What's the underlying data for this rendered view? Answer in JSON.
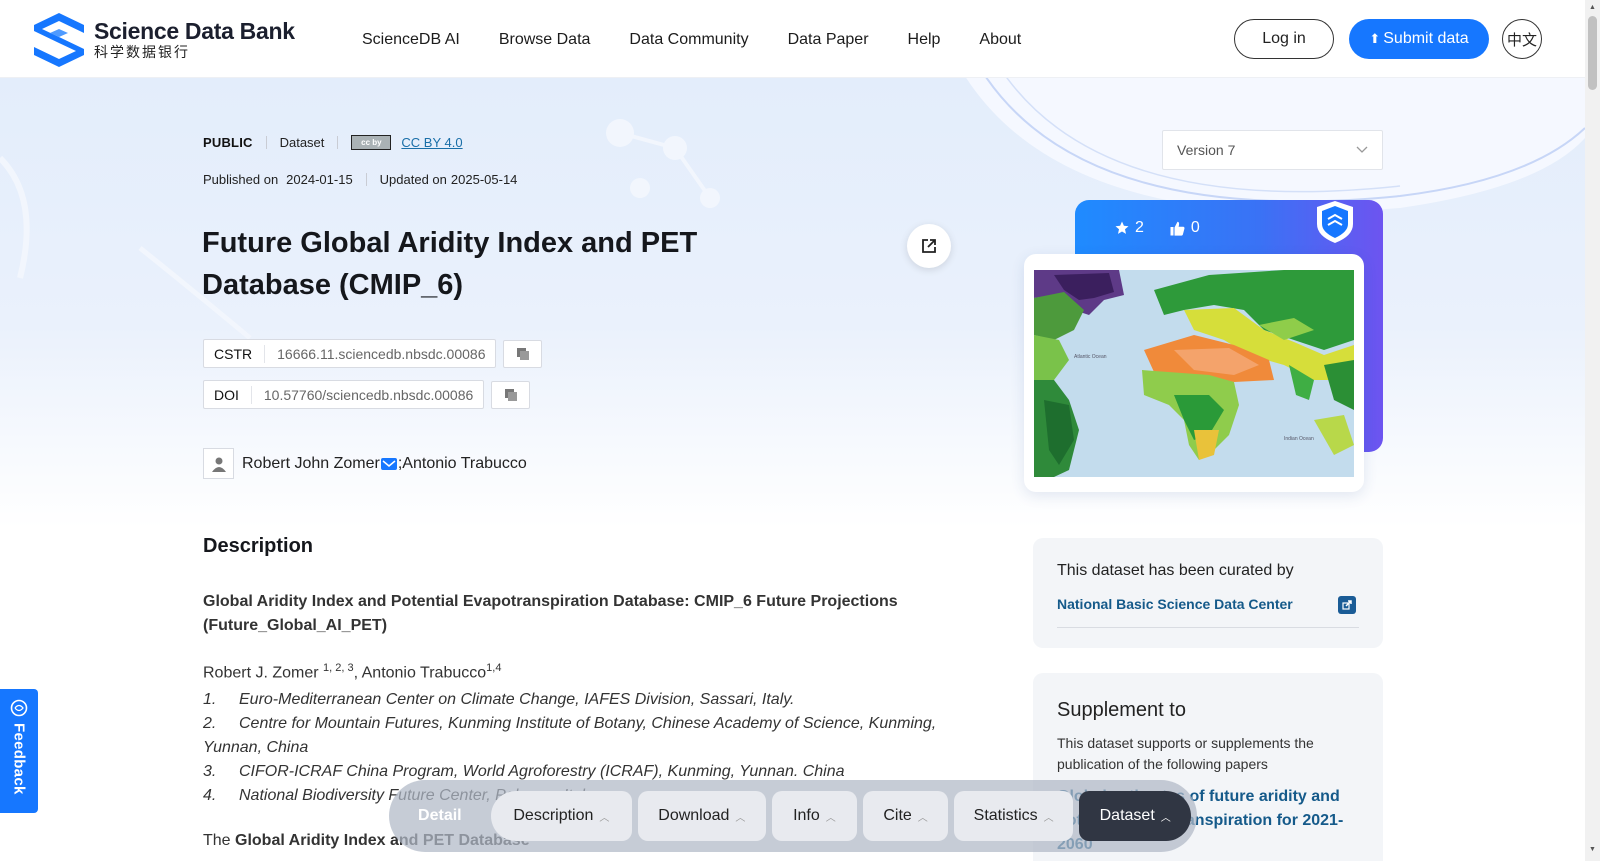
{
  "header": {
    "logo_en": "Science Data Bank",
    "logo_cn": "科学数据银行",
    "nav": [
      "ScienceDB AI",
      "Browse Data",
      "Data Community",
      "Data Paper",
      "Help",
      "About"
    ],
    "login": "Log in",
    "submit": "Submit data",
    "lang": "中文"
  },
  "dataset": {
    "visibility": "PUBLIC",
    "type": "Dataset",
    "cc_badge": "cc by",
    "license": "CC BY 4.0",
    "published_label": "Published on",
    "published": "2024-01-15",
    "updated_label": "Updated on",
    "updated": "2025-05-14",
    "title": "Future Global Aridity Index and PET Database (CMIP_6)",
    "cstr_label": "CSTR",
    "cstr": "16666.11.sciencedb.nbsdc.00086",
    "doi_label": "DOI",
    "doi": "10.57760/sciencedb.nbsdc.00086",
    "author1": "Robert John Zomer",
    "author_sep": "; ",
    "author2": "Antonio Trabucco"
  },
  "side": {
    "version": "Version 7",
    "stars": "2",
    "likes": "0",
    "curated_text": "This dataset has been curated by",
    "curated_by": "National Basic Science Data Center",
    "supplement_heading": "Supplement to",
    "supplement_text": "This dataset supports or supplements the publication of the following papers",
    "supplement_link": "Global estimates of future aridity and potential evapotranspiration for 2021-2060"
  },
  "description": {
    "heading": "Description",
    "subtitle": "Global Aridity Index and Potential Evapotranspiration Database: CMIP_6 Future Projections (Future_Global_AI_PET)",
    "author_a": "Robert J. Zomer ",
    "author_a_sup": "1, 2, 3",
    "author_b": ", Antonio Trabucco",
    "author_b_sup": "1,4",
    "affiliations": [
      {
        "num": "1.",
        "text": "Euro-Mediterranean Center on Climate Change, IAFES Division, Sassari, Italy."
      },
      {
        "num": "2.",
        "text": "Centre for Mountain Futures, Kunming Institute of Botany, Chinese Academy of Science, Kunming, Yunnan, China"
      },
      {
        "num": "3.",
        "text": "CIFOR-ICRAF China Program, World Agroforestry (ICRAF), Kunming, Yunnan. China"
      },
      {
        "num": "4.",
        "text": "National Biodiversity Future Center, Palermo, Italy"
      }
    ],
    "paragraph_start": "The ",
    "paragraph_bold": "Global Aridity Index and PET Database"
  },
  "feedback": "Feedback",
  "bottom_bar": {
    "detail": "Detail",
    "tabs": [
      "Description",
      "Download",
      "Info",
      "Cite",
      "Statistics",
      "Dataset"
    ],
    "active": "Dataset"
  },
  "map_labels": {
    "atlantic": "Atlantic Ocean",
    "indian": "Indian Ocean"
  },
  "colors": {
    "primary": "#1677ff",
    "link": "#155a8a",
    "dark_tab": "#303643"
  }
}
